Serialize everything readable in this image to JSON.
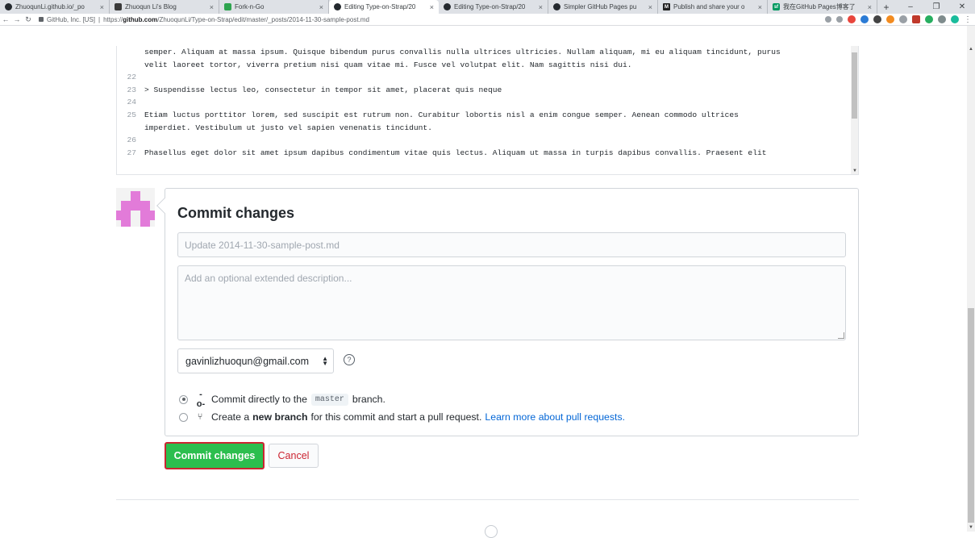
{
  "browser": {
    "tabs": [
      {
        "title": "ZhuoqunLi.github.io/_po",
        "favicon": "github-icon"
      },
      {
        "title": "Zhuoqun Li's Blog",
        "favicon": "blog-icon"
      },
      {
        "title": "Fork-n-Go",
        "favicon": "fork-icon"
      },
      {
        "title": "Editing Type-on-Strap/20",
        "favicon": "github-icon",
        "active": true
      },
      {
        "title": "Editing Type-on-Strap/20",
        "favicon": "github-icon"
      },
      {
        "title": "Simpler GitHub Pages pu",
        "favicon": "github-icon"
      },
      {
        "title": "Publish and share your o",
        "favicon": "medium-icon"
      },
      {
        "title": "我在GitHub Pages博客了",
        "favicon": "sf-icon"
      }
    ],
    "new_tab": "+",
    "url_org": "GitHub, Inc. [US]",
    "url_scheme": "https://",
    "url_host": "github.com",
    "url_path": "/ZhuoqunLi/Type-on-Strap/edit/master/_posts/2014-11-30-sample-post.md"
  },
  "editor": {
    "lines": [
      {
        "num": "",
        "text": "semper. Aliquam at massa ipsum. Quisque bibendum purus convallis nulla ultrices ultricies. Nullam aliquam, mi eu aliquam tincidunt, purus"
      },
      {
        "num": "",
        "text": "velit laoreet tortor, viverra pretium nisi quam vitae mi. Fusce vel volutpat elit. Nam sagittis nisi dui."
      },
      {
        "num": "22",
        "text": ""
      },
      {
        "num": "23",
        "text": "> Suspendisse lectus leo, consectetur in tempor sit amet, placerat quis neque"
      },
      {
        "num": "24",
        "text": ""
      },
      {
        "num": "25",
        "text": "Etiam luctus porttitor lorem, sed suscipit est rutrum non. Curabitur lobortis nisl a enim congue semper. Aenean commodo ultrices"
      },
      {
        "num": "",
        "text": "imperdiet. Vestibulum ut justo vel sapien venenatis tincidunt."
      },
      {
        "num": "26",
        "text": ""
      },
      {
        "num": "27",
        "text": "Phasellus eget dolor sit amet ipsum dapibus condimentum vitae quis lectus. Aliquam ut massa in turpis dapibus convallis. Praesent elit"
      }
    ]
  },
  "commit": {
    "title": "Commit changes",
    "summary_placeholder": "Update 2014-11-30-sample-post.md",
    "description_placeholder": "Add an optional extended description...",
    "email": "gavinlizhuoqun@gmail.com",
    "help": "?",
    "option_direct_pre": "Commit directly to the",
    "option_direct_branch": "master",
    "option_direct_post": "branch.",
    "option_new_pre": "Create a",
    "option_new_bold": "new branch",
    "option_new_post": "for this commit and start a pull request.",
    "option_new_link": "Learn more about pull requests.",
    "submit_label": "Commit changes",
    "cancel_label": "Cancel"
  }
}
